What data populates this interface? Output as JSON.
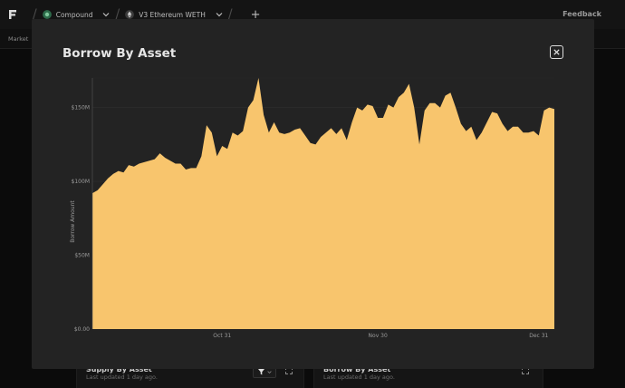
{
  "topbar": {
    "crumbs": [
      {
        "label": "Compound",
        "icon": "compound-icon"
      },
      {
        "label": "V3 Ethereum WETH",
        "icon": "ethereum-icon"
      }
    ],
    "feedback_label": "Feedback"
  },
  "subnav": {
    "tab_label": "Market"
  },
  "background_cards": [
    {
      "title": "Supply By Asset",
      "subtitle": "Last updated 1 day ago."
    },
    {
      "title": "Borrow By Asset",
      "subtitle": "Last updated 1 day ago."
    }
  ],
  "modal": {
    "title": "Borrow By Asset"
  },
  "colors": {
    "area_fill": "#f8c56d",
    "modal_bg": "#232323",
    "page_bg": "#0b0b0b"
  },
  "chart_data": {
    "type": "area",
    "ylabel": "Borrow Amount",
    "ylim": [
      0,
      170
    ],
    "y_unit": "M",
    "y_ticks": [
      {
        "value": 0,
        "label": "$0.00"
      },
      {
        "value": 50,
        "label": "$50M"
      },
      {
        "value": 100,
        "label": "$100M"
      },
      {
        "value": 150,
        "label": "$150M"
      }
    ],
    "x_ticks": [
      {
        "index": 25,
        "label": "Oct 31"
      },
      {
        "index": 55,
        "label": "Nov 30"
      },
      {
        "index": 86,
        "label": "Dec 31"
      }
    ],
    "grid": true,
    "series": [
      {
        "values": [
          92,
          94,
          98,
          102,
          105,
          107,
          106,
          111,
          110,
          112,
          113,
          114,
          115,
          119,
          116,
          114,
          112,
          112,
          108,
          109,
          109,
          117,
          138,
          133,
          117,
          124,
          122,
          133,
          131,
          134,
          150,
          155,
          170,
          145,
          133,
          140,
          133,
          132,
          133,
          135,
          136,
          131,
          126,
          125,
          130,
          133,
          136,
          132,
          136,
          128,
          140,
          150,
          148,
          152,
          151,
          143,
          143,
          152,
          150,
          157,
          160,
          166,
          150,
          125,
          148,
          153,
          153,
          150,
          158,
          160,
          150,
          139,
          134,
          137,
          128,
          133,
          140,
          147,
          146,
          139,
          134,
          137,
          137,
          133,
          133,
          134,
          131,
          148,
          150,
          149
        ]
      }
    ]
  }
}
